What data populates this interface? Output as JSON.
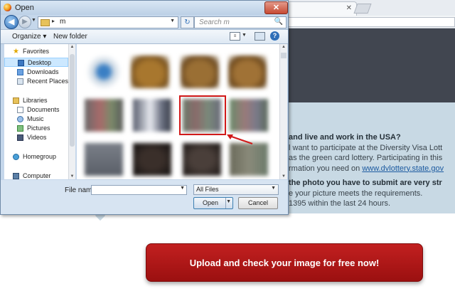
{
  "dialog": {
    "title": "Open",
    "close_glyph": "✕",
    "nav": {
      "back_glyph": "◀",
      "forward_glyph": "▶",
      "path_separator": "▸",
      "path_folder": "m",
      "refresh_glyph": "↻",
      "search_placeholder": "Search m",
      "search_icon": "🔍"
    },
    "toolbar": {
      "organize": "Organize ▾",
      "new_folder": "New folder",
      "help_glyph": "?"
    },
    "sidebar": {
      "items": [
        {
          "label": "Favorites",
          "icon": "star-icon"
        },
        {
          "label": "Desktop",
          "icon": "desktop-icon"
        },
        {
          "label": "Downloads",
          "icon": "downloads-icon"
        },
        {
          "label": "Recent Places",
          "icon": "recent-places-icon"
        },
        {
          "label": "Libraries",
          "icon": "libraries-icon"
        },
        {
          "label": "Documents",
          "icon": "documents-icon"
        },
        {
          "label": "Music",
          "icon": "music-icon"
        },
        {
          "label": "Pictures",
          "icon": "pictures-icon"
        },
        {
          "label": "Videos",
          "icon": "videos-icon"
        },
        {
          "label": "Homegroup",
          "icon": "homegroup-icon"
        },
        {
          "label": "Computer",
          "icon": "computer-icon"
        }
      ],
      "selected": "Desktop"
    },
    "file_name_label": "File name:",
    "file_name_value": "",
    "file_type": "All Files",
    "open_button": "Open",
    "cancel_button": "Cancel",
    "highlight_color": "#d11a1a"
  },
  "page": {
    "question": "and live and work in the USA?",
    "line1": "l want to participate at the Diversity Visa Lott",
    "line2": "as the green card lottery. Participating in this",
    "line3_prefix": "rmation you need on ",
    "line3_link": "www.dvlottery.state.gov",
    "question2": "the photo you have to submit are very str",
    "line4": "e your picture meets the requirements.",
    "line5": "1395 within the last 24 hours.",
    "upload_button": "Upload and check your image for free now!",
    "upload_color": "#b01818"
  }
}
